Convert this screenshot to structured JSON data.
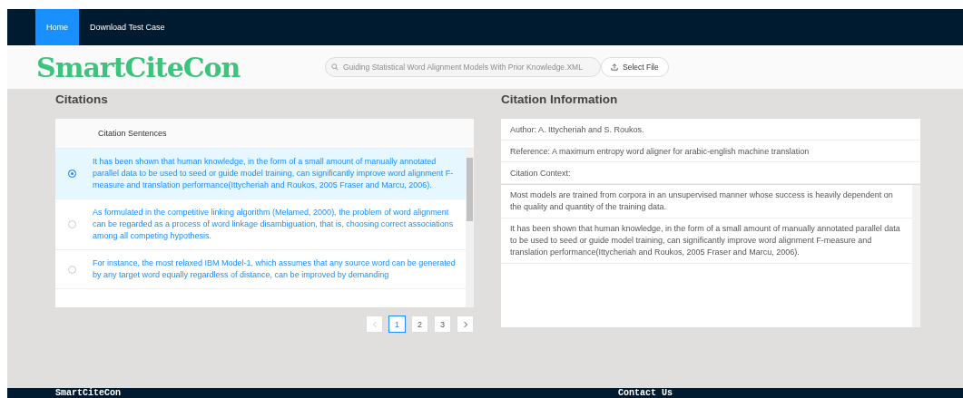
{
  "nav": {
    "tabs": [
      {
        "label": "Home",
        "selected": true
      },
      {
        "label": "Download Test Case",
        "selected": false
      }
    ]
  },
  "header": {
    "logo": "SmartCiteCon",
    "file_field": {
      "value": "Guiding Statistical Word Alignment Models With Prior Knowledge.XML",
      "disabled": true
    },
    "select_button": "Select File"
  },
  "citations": {
    "title": "Citations",
    "column": "Citation Sentences",
    "rows": [
      {
        "text": "It has been shown that human knowledge, in the form of a small amount of manually annotated parallel data to be used to seed or guide model training, can significantly improve word alignment F-measure and translation performance(Ittycheriah and Roukos, 2005 Fraser and Marcu, 2006).",
        "selected": true
      },
      {
        "text": "As formulated in the competitive linking algorithm (Melamed, 2000), the problem of word alignment can be regarded as a process of word linkage disambiguation, that is, choosing correct associations among all competing hypothesis.",
        "selected": false
      },
      {
        "text": "For instance, the most relaxed IBM Model-1, which assumes that any source word can be generated by any target word equally regardless of distance, can be improved by demanding",
        "selected": false
      }
    ],
    "pagination": {
      "prev_disabled": true,
      "next_disabled": false,
      "pages": [
        {
          "label": "1",
          "selected": true
        },
        {
          "label": "2",
          "selected": false
        },
        {
          "label": "3",
          "selected": false
        }
      ]
    }
  },
  "info": {
    "title": "Citation Information",
    "author": "Author: A. Ittycheriah and S. Roukos.",
    "reference": "Reference: A maximum entropy word aligner for arabic-english machine translation",
    "context_label": "Citation Context:",
    "context": [
      "Most models are trained from corpora in an unsupervised manner whose success is heavily dependent on the quality and quantity of the training data.",
      "It has been shown that human knowledge, in the form of a small amount of manually annotated parallel data to be used to seed or guide model training, can significantly improve word alignment F-measure and translation performance(Ittycheriah and Roukos, 2005 Fraser and Marcu, 2006)."
    ]
  },
  "footer": {
    "left": "SmartCiteCon",
    "right": "Contact Us"
  }
}
